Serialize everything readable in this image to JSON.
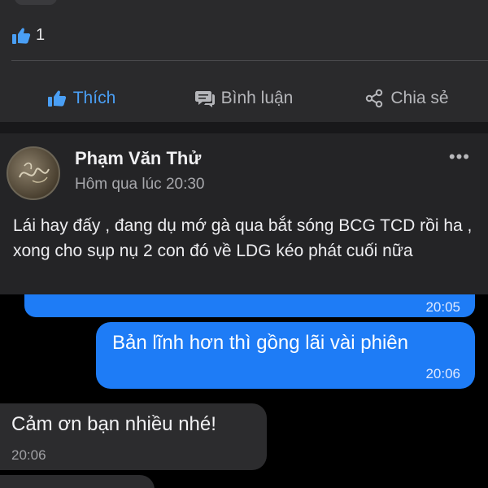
{
  "reactions": {
    "count": "1"
  },
  "actions": {
    "like": "Thích",
    "comment": "Bình luận",
    "share": "Chia sẻ"
  },
  "post": {
    "author": "Phạm Văn Thử",
    "time": "Hôm qua lúc 20:30",
    "more": "•••",
    "text": "Lái hay đấy , đang dụ mớ gà qua bắt sóng BCG TCD rồi ha , xong cho sụp nụ 2 con đó về LDG kéo phát cuối nữa",
    "screenshot": {
      "top_time": "20:05",
      "outgoing": {
        "text": "Bản lĩnh hơn thì gồng lãi vài phiên",
        "time": "20:06"
      },
      "incoming": {
        "text": "Cảm ơn bạn nhiều nhé!",
        "time": "20:06"
      }
    }
  },
  "colors": {
    "accent": "#4a9ff5",
    "bubble_blue": "#1e7cf6",
    "background": "#242426"
  }
}
